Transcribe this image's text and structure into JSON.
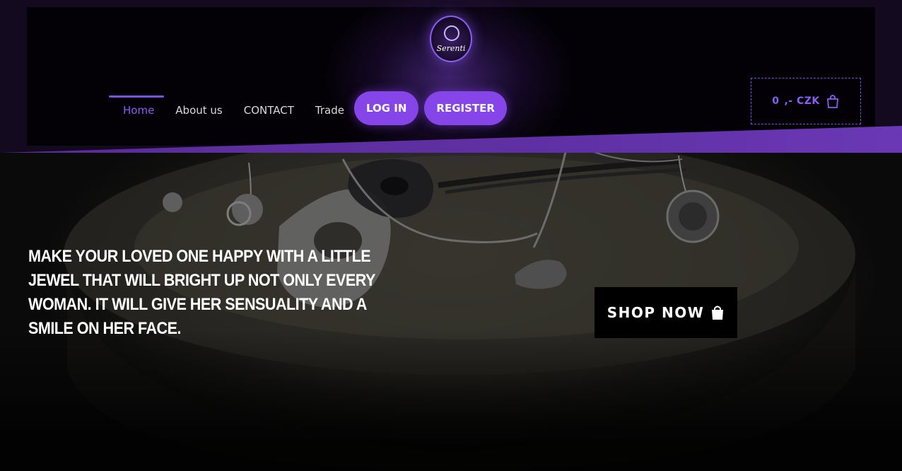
{
  "brand": {
    "logo_text": "Serenti"
  },
  "nav": {
    "items": [
      {
        "label": "Home",
        "active": true
      },
      {
        "label": "About us",
        "active": false
      },
      {
        "label": "CONTACT",
        "active": false
      },
      {
        "label": "Trade",
        "active": false
      }
    ],
    "login_label": "LOG IN",
    "register_label": "REGISTER"
  },
  "cart": {
    "amount": "0",
    "currency": ",- CZK",
    "icon": "shopping-bag-icon"
  },
  "hero": {
    "tagline": "MAKE YOUR LOVED ONE HAPPY WITH A LITTLE JEWEL THAT WILL BRIGHT UP NOT ONLY EVERY WOMAN. IT WILL GIVE HER SENSUALITY AND A SMILE ON HER FACE.",
    "shop_button_label": "SHOP NOW",
    "shop_button_icon": "shopping-bag-icon"
  },
  "colors": {
    "accent": "#8545e8",
    "accent_text": "#8b5cf6",
    "header_bg": "#030105",
    "header_outer": "#140a1f"
  }
}
